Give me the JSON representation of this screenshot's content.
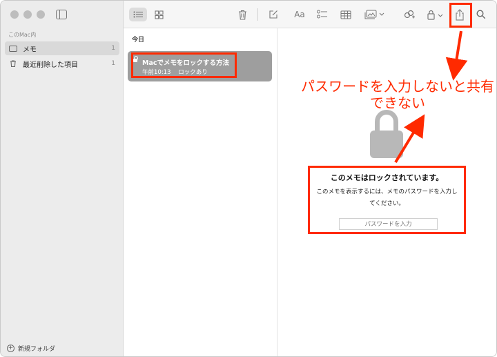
{
  "sidebar": {
    "section_label": "このMac内",
    "folders": [
      {
        "label": "メモ",
        "count": "1"
      },
      {
        "label": "最近削除した項目",
        "count": "1"
      }
    ],
    "new_folder_label": "新規フォルダ"
  },
  "toolbar": {
    "font_label": "Aa"
  },
  "note_list": {
    "date_header": "今日",
    "note": {
      "title": "Macでメモをロックする方法",
      "time": "午前10:13",
      "status": "ロックあり"
    }
  },
  "detail": {
    "heading": "このメモはロックされています。",
    "description": "このメモを表示するには、メモのパスワードを入力してください。",
    "password_placeholder": "パスワードを入力"
  },
  "annotation": {
    "text": "パスワードを入力しないと共有できない"
  },
  "colors": {
    "highlight": "#ff2a00",
    "selected_note": "#9e9e9e",
    "sidebar_bg": "#ececec"
  }
}
